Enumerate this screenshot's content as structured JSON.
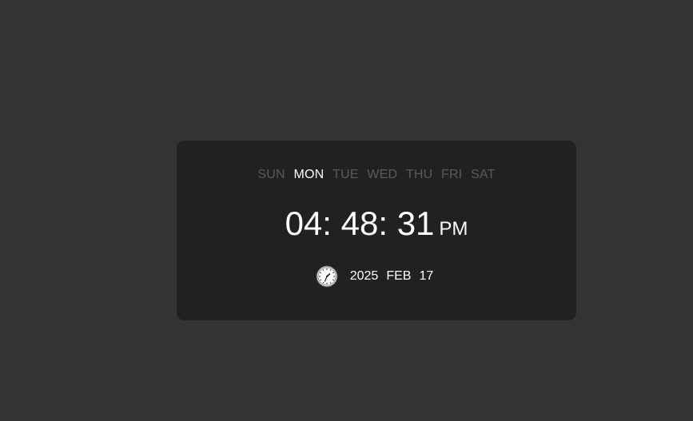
{
  "weekdays": [
    {
      "label": "SUN",
      "active": false
    },
    {
      "label": "MON",
      "active": true
    },
    {
      "label": "TUE",
      "active": false
    },
    {
      "label": "WED",
      "active": false
    },
    {
      "label": "THU",
      "active": false
    },
    {
      "label": "FRI",
      "active": false
    },
    {
      "label": "SAT",
      "active": false
    }
  ],
  "time": {
    "display": "04: 48: 31",
    "ampm": "PM"
  },
  "date": {
    "year": "2025",
    "month": "FEB",
    "day": "17",
    "icon": "analog-clock-icon"
  },
  "colors": {
    "background": "#333333",
    "card": "#212121",
    "active_text": "#ffffff",
    "inactive_text": "#5a5a5a"
  }
}
